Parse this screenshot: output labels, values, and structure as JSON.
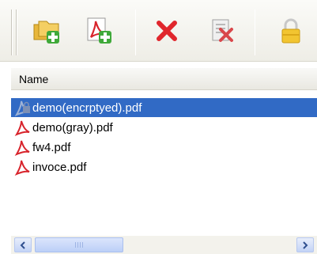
{
  "toolbar": {
    "buttons": [
      {
        "id": "add-folder",
        "icon": "add-folder-icon"
      },
      {
        "id": "add-pdf",
        "icon": "add-pdf-icon"
      },
      {
        "id": "remove",
        "icon": "red-x-icon"
      },
      {
        "id": "remove-all",
        "icon": "clear-list-icon"
      },
      {
        "id": "encrypt",
        "icon": "padlock-icon"
      }
    ]
  },
  "list": {
    "column_name": "Name",
    "files": [
      {
        "name": "demo(encrptyed).pdf",
        "icon": "encrypted-pdf-icon",
        "selected": true
      },
      {
        "name": "demo(gray).pdf",
        "icon": "pdf-icon",
        "selected": false
      },
      {
        "name": "fw4.pdf",
        "icon": "pdf-icon",
        "selected": false
      },
      {
        "name": "invoce.pdf",
        "icon": "pdf-icon",
        "selected": false
      }
    ]
  },
  "colors": {
    "selection": "#316ac5",
    "pdf_red": "#d8242c",
    "toolbar_bg": "#f3f2ec"
  }
}
